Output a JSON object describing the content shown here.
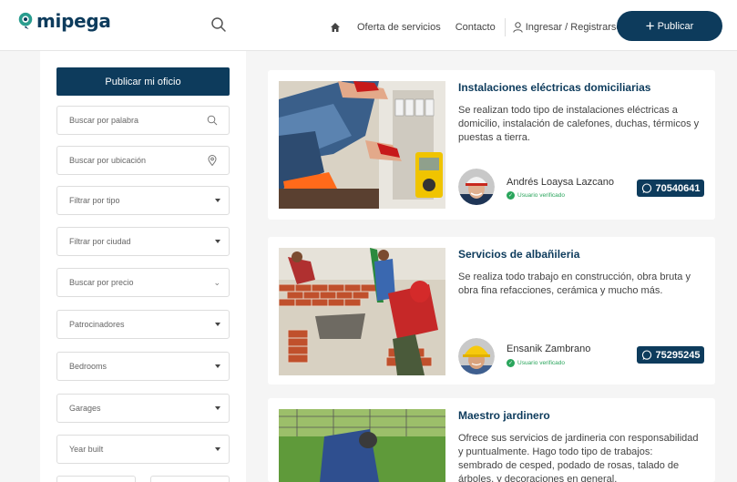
{
  "header": {
    "logo_text": "mipega",
    "nav": {
      "services": "Oferta de servicios",
      "contact": "Contacto",
      "login": "Ingresar / Registrarse"
    },
    "publish_label": "Publicar"
  },
  "sidebar": {
    "publish_label": "Publicar mi oficio",
    "fields": [
      {
        "placeholder": "Buscar por palabra",
        "icon": "search-icon"
      },
      {
        "placeholder": "Buscar por ubicación",
        "icon": "location-pin-icon"
      },
      {
        "placeholder": "Filtrar por tipo",
        "icon": "caret-down-icon"
      },
      {
        "placeholder": "Filtrar por ciudad",
        "icon": "caret-down-icon"
      },
      {
        "placeholder": "Buscar por precio",
        "icon": "chevron-down-icon"
      },
      {
        "placeholder": "Patrocinadores",
        "icon": "caret-down-icon"
      },
      {
        "placeholder": "Bedrooms",
        "icon": "caret-down-icon"
      },
      {
        "placeholder": "Garages",
        "icon": "caret-down-icon"
      },
      {
        "placeholder": "Year built",
        "icon": "caret-down-icon"
      }
    ]
  },
  "listings": [
    {
      "title": "Instalaciones eléctricas domiciliarias",
      "description": "Se realizan todo tipo de instalaciones eléctricas a domicilio, instalación de calefones, duchas, térmicos y puestas a tierra.",
      "user": "Andrés Loaysa Lazcano",
      "verified": "Usuario verificado",
      "phone": "70540641"
    },
    {
      "title": "Servicios de albañileria",
      "description": "Se realiza todo trabajo en construcción, obra bruta y obra fina refacciones, cerámica y mucho más.",
      "user": "Ensanik Zambrano",
      "verified": "Usuario verificado",
      "phone": "75295245"
    },
    {
      "title": "Maestro jardinero",
      "description": "Ofrece sus servicios de jardineria con responsabilidad y puntualmente. Hago todo tipo de trabajos: sembrado de cesped, podado de rosas, talado de árboles, y decoraciones en general."
    }
  ],
  "colors": {
    "brand": "#0d3b5c",
    "accent": "#2a9d8f",
    "verified": "#2aa55c"
  }
}
